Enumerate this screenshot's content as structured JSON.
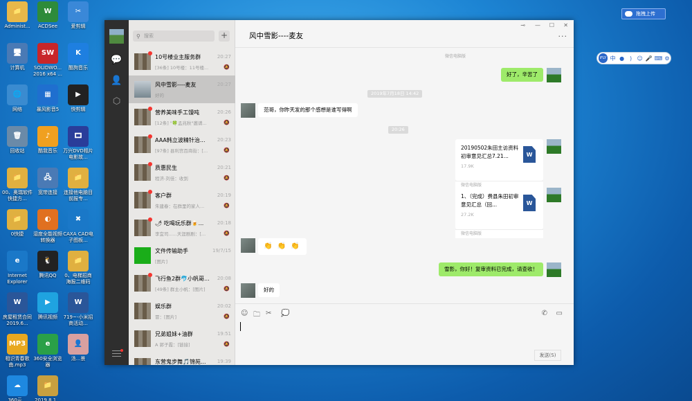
{
  "desktop": {
    "icons": [
      {
        "label": "Administ...",
        "glyph": "📁",
        "color": "#e8b84a"
      },
      {
        "label": "ACDSee",
        "glyph": "W",
        "color": "#2e8b3a"
      },
      {
        "label": "爱剪辑",
        "glyph": "✂",
        "color": "#3a88d8"
      },
      {
        "label": "计算机",
        "glyph": "🖥",
        "color": "#4a7ab5"
      },
      {
        "label": "SOLIDWO... 2016 x64 ...",
        "glyph": "SW",
        "color": "#c8262a"
      },
      {
        "label": "酷狗音乐",
        "glyph": "K",
        "color": "#1e7fe0"
      },
      {
        "label": "网络",
        "glyph": "🌐",
        "color": "#3a8bd0"
      },
      {
        "label": "暴风影音5",
        "glyph": "▦",
        "color": "#1f6fcf"
      },
      {
        "label": "快剪辑",
        "glyph": "▶",
        "color": "#222222"
      },
      {
        "label": "回收站",
        "glyph": "🗑",
        "color": "#6a8aa8"
      },
      {
        "label": "酷我音乐",
        "glyph": "♪",
        "color": "#f0a020"
      },
      {
        "label": "万兴DVD相片电影故...",
        "glyph": "🎞",
        "color": "#2a3d9a"
      },
      {
        "label": "00、奥瑞软件快捷方...",
        "glyph": "📁",
        "color": "#e0b040"
      },
      {
        "label": "宽带连接",
        "glyph": "🖧",
        "color": "#4a7ab5"
      },
      {
        "label": "连接他电脑目前报专...",
        "glyph": "📁",
        "color": "#e0b040"
      },
      {
        "label": "0快捷",
        "glyph": "📁",
        "color": "#e0b040"
      },
      {
        "label": "湿度全能视频转换器",
        "glyph": "◐",
        "color": "#e07020"
      },
      {
        "label": "CAXA CAD电子图板...",
        "glyph": "✖",
        "color": "#1a78c8"
      },
      {
        "label": "Internet Explorer",
        "glyph": "e",
        "color": "#1a78c8"
      },
      {
        "label": "腾讯QQ",
        "glyph": "🐧",
        "color": "#222222"
      },
      {
        "label": "0、电梯招商海报二维码",
        "glyph": "📁",
        "color": "#e0b040"
      },
      {
        "label": "房屋租赁合同2019.6...",
        "glyph": "W",
        "color": "#2a5699"
      },
      {
        "label": "腾讯视频",
        "glyph": "▶",
        "color": "#1fa3e0"
      },
      {
        "label": "719~-小米招商活动...",
        "glyph": "W",
        "color": "#2a5699"
      },
      {
        "label": "相识青春歌曲.mp3",
        "glyph": "MP3",
        "color": "#e8a820"
      },
      {
        "label": "360安全浏览器",
        "glyph": "e",
        "color": "#2aa048"
      },
      {
        "label": "汤...景",
        "glyph": "👤",
        "color": "#d8a0a0"
      },
      {
        "label": "360云...",
        "glyph": "☁",
        "color": "#1e88e0"
      },
      {
        "label": "2019.8.1...",
        "glyph": "📁",
        "color": "#c8a040"
      }
    ]
  },
  "tray": {
    "baidu_label": "拖拽上传",
    "ime_items": [
      "中",
      "●",
      ")",
      "☺",
      "🎤",
      "⌨",
      "⚙"
    ]
  },
  "chat_list": {
    "search_placeholder": "搜索",
    "add_label": "+",
    "chats": [
      {
        "name": "10号楼业主服务群",
        "time": "20:27",
        "preview": "[36条] 10号楼：11号楼...",
        "unread": true,
        "muted": true,
        "avatar": "grid"
      },
      {
        "name": "风中雪影----麦友",
        "time": "20:27",
        "preview": "好的",
        "unread": false,
        "muted": false,
        "avatar": "pic",
        "selected": true
      },
      {
        "name": "营养美味手工馒吨",
        "time": "20:26",
        "preview": "[12条] \"🍀孟兆秋\"邀请...",
        "unread": true,
        "muted": true,
        "avatar": "grid"
      },
      {
        "name": "AAA韩立波精针治...",
        "time": "20:23",
        "preview": "[97条] 县利宫百商街：[...",
        "unread": true,
        "muted": true,
        "avatar": "grid"
      },
      {
        "name": "质惠民生",
        "time": "20:21",
        "preview": "程济-刘佳：收到",
        "unread": true,
        "muted": true,
        "avatar": "grid"
      },
      {
        "name": "客户群",
        "time": "20:19",
        "preview": "朱建春：在群里的家人...",
        "unread": true,
        "muted": true,
        "avatar": "grid"
      },
      {
        "name": "🌶 吃喝玩乐群🍺...",
        "time": "20:18",
        "preview": "李宜司......天涯剧剧：[...",
        "unread": true,
        "muted": true,
        "avatar": "grid"
      },
      {
        "name": "文件传输助手",
        "time": "19/7/15",
        "preview": "[图片]",
        "unread": false,
        "muted": false,
        "avatar": "green"
      },
      {
        "name": "飞行鱼2群🐬小帆哥...",
        "time": "20:08",
        "preview": "[49条] 群主小帆：[图片]",
        "unread": true,
        "muted": true,
        "avatar": "grid"
      },
      {
        "name": "娱乐群",
        "time": "20:02",
        "preview": "冒：[图片]",
        "unread": false,
        "muted": true,
        "avatar": "grid"
      },
      {
        "name": "兄弟姐妹+油群",
        "time": "19:51",
        "preview": "A 郭子霞：[链接]",
        "unread": false,
        "muted": true,
        "avatar": "grid"
      },
      {
        "name": "东营鬼步舞🎵锦苑...",
        "time": "19:39",
        "preview": "孔...1[图片]：[...",
        "unread": false,
        "muted": true,
        "avatar": "grid"
      }
    ]
  },
  "window": {
    "pin_icon": "⊸",
    "min_icon": "—",
    "max_icon": "☐",
    "close_icon": "✕"
  },
  "conversation": {
    "title": "风中雪影----麦友",
    "more_label": "···",
    "messages": {
      "src_top": "微信电脑版",
      "m1": "好了，辛苦了",
      "ts1": "2019年7月18日 14:42",
      "m2": "范哥，你昨天发的那个感想是谁写得啊",
      "ts2": "20:26",
      "file1_name": "20190502朱田主访资料初审意见汇总7.21...",
      "file1_size": "17.9K",
      "file1_src": "微信电脑版",
      "file2_name": "1、（完成）费县朱田初审意见汇总（回...",
      "file2_size": "27.2K",
      "file2_src": "微信电脑版",
      "m3": "👏 👏 👏",
      "m4": "雪影，你好！复审资料已完成，请查收！",
      "m5": "好的"
    },
    "send_label": "发送(S)"
  },
  "colors": {
    "wechat_green": "#1aad19",
    "bubble_green": "#9eea6a",
    "sidebar_dark": "#2e2e2e",
    "unread_red": "#f43530"
  }
}
